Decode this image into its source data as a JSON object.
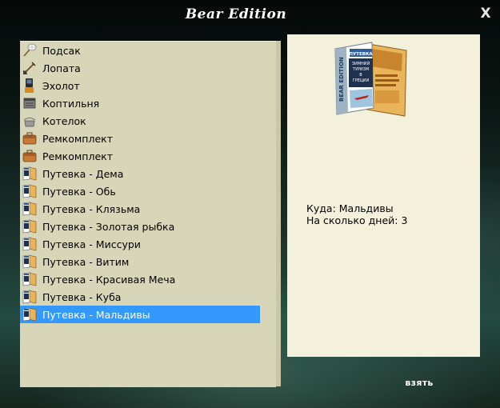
{
  "window": {
    "title": "Bear Edition",
    "close_label": "X"
  },
  "inventory": {
    "items": [
      {
        "label": "Подсак",
        "icon": "landing-net-icon"
      },
      {
        "label": "Лопата",
        "icon": "shovel-icon"
      },
      {
        "label": "Эхолот",
        "icon": "echo-sounder-icon"
      },
      {
        "label": "Коптильня",
        "icon": "smokehouse-icon"
      },
      {
        "label": "Котелок",
        "icon": "cooking-pot-icon"
      },
      {
        "label": "Ремкомплект",
        "icon": "repair-kit-icon"
      },
      {
        "label": "Ремкомплект",
        "icon": "repair-kit-icon"
      },
      {
        "label": "Путевка - Дема",
        "icon": "travel-voucher-icon"
      },
      {
        "label": "Путевка - Обь",
        "icon": "travel-voucher-icon"
      },
      {
        "label": "Путевка - Клязьма",
        "icon": "travel-voucher-icon"
      },
      {
        "label": "Путевка - Золотая рыбка",
        "icon": "travel-voucher-icon"
      },
      {
        "label": "Путевка - Миссури",
        "icon": "travel-voucher-icon"
      },
      {
        "label": "Путевка - Витим",
        "icon": "travel-voucher-icon"
      },
      {
        "label": "Путевка - Красивая Меча",
        "icon": "travel-voucher-icon"
      },
      {
        "label": "Путевка - Куба",
        "icon": "travel-voucher-icon"
      },
      {
        "label": "Путевка - Мальдивы",
        "icon": "travel-voucher-icon",
        "selected": true
      }
    ]
  },
  "detail": {
    "booklet_text": {
      "brand": "BEAR EDITION",
      "header": "ПУТЕВКА",
      "lines": [
        "ЗИМНИЙ",
        "ТУРИЗМ",
        "В",
        "ГРЕЦИИ"
      ]
    },
    "destination_line": "Куда: Мальдивы",
    "days_line": "На сколько дней: 3"
  },
  "actions": {
    "take_label": "взять"
  },
  "colors": {
    "list_bg": "#d8d6b8",
    "detail_bg": "#f3f1dc",
    "selection": "#3399ff"
  }
}
